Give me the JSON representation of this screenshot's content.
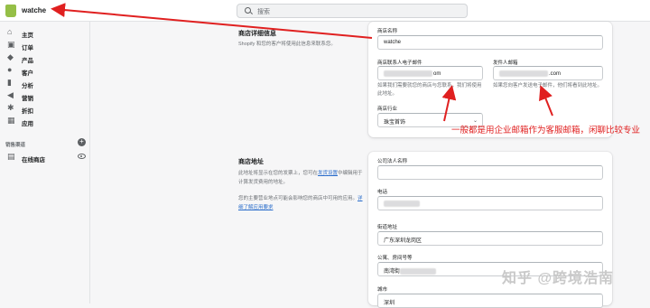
{
  "topbar": {
    "store_name": "watche",
    "search_placeholder": "搜索"
  },
  "sidebar": {
    "items": [
      {
        "label": "主页",
        "icon": "home-icon"
      },
      {
        "label": "订单",
        "icon": "orders-icon"
      },
      {
        "label": "产品",
        "icon": "tag-icon"
      },
      {
        "label": "客户",
        "icon": "person-icon"
      },
      {
        "label": "分析",
        "icon": "bar-chart-icon"
      },
      {
        "label": "营销",
        "icon": "megaphone-icon"
      },
      {
        "label": "折扣",
        "icon": "discount-icon"
      },
      {
        "label": "应用",
        "icon": "apps-icon"
      }
    ],
    "channels_label": "销售渠道",
    "channel": {
      "label": "在线商店",
      "icon": "store-icon"
    }
  },
  "store_details": {
    "title": "商店详细信息",
    "description": "Shopify 和您的客户将使用此信息来联系您。",
    "store_name_label": "商店名称",
    "store_name_value": "watche",
    "contact_email_label": "商店联系人电子邮件",
    "contact_email_suffix": "om",
    "contact_email_help": "如果我们需要就您的商店与您联系，我们将使用此地址。",
    "sender_email_label": "发件人邮箱",
    "sender_email_suffix": ".com",
    "sender_email_help": "如果您向客户发送电子邮件，他们将看到此地址。",
    "industry_label": "商店行业",
    "industry_value": "珠宝首饰"
  },
  "store_address": {
    "title": "商店地址",
    "desc1": "此地址将显示在您的发票上，您可在",
    "desc1_link": "发货设置",
    "desc1_tail": "中编辑用于计算发货费用的地址。",
    "desc2": "您的主要营业地点可能会影响您的商店中可用的应用。",
    "desc2_link": "详细了解应用要求",
    "legal_name_label": "公司法人名称",
    "phone_label": "电话",
    "street_label": "街道地址",
    "street_value": "广东深圳龙岗区",
    "apt_label": "公寓、房间号等",
    "apt_value": "南湾街",
    "city_label": "城市",
    "city_value": "深圳"
  },
  "annotation": "一般都是用企业邮箱作为客服邮箱，闲聊比较专业",
  "watermark": "知乎 @跨境浩南",
  "colors": {
    "annotation_red": "#e02020",
    "brand_green": "#95bf47",
    "link_blue": "#2c6ecb"
  }
}
